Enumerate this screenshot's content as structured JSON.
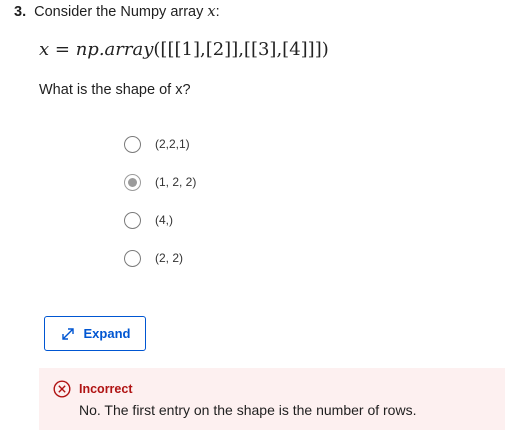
{
  "question": {
    "number": "3.",
    "text": "Consider the Numpy array",
    "variable": "x",
    "suffix": ":",
    "formula": {
      "lhs": "x",
      "equals": "=",
      "rhs_func": "np.array",
      "rhs_args": "([[[1],[2]],[[3],[4]]])"
    },
    "prompt": "What is the shape of x?"
  },
  "options": [
    {
      "label": "(2,2,1)",
      "selected": false
    },
    {
      "label": "(1, 2, 2)",
      "selected": true
    },
    {
      "label": "(4,)",
      "selected": false
    },
    {
      "label": "(2, 2)",
      "selected": false
    }
  ],
  "expand_button": {
    "label": "Expand",
    "icon": "expand-arrows-icon"
  },
  "feedback": {
    "status": "Incorrect",
    "message": "No. The first entry on the shape is the number of rows.",
    "icon": "incorrect-x-circle-icon",
    "color": "#b01313",
    "background": "#fdf0f0"
  },
  "colors": {
    "accent": "#0056d2",
    "error": "#b01313"
  }
}
